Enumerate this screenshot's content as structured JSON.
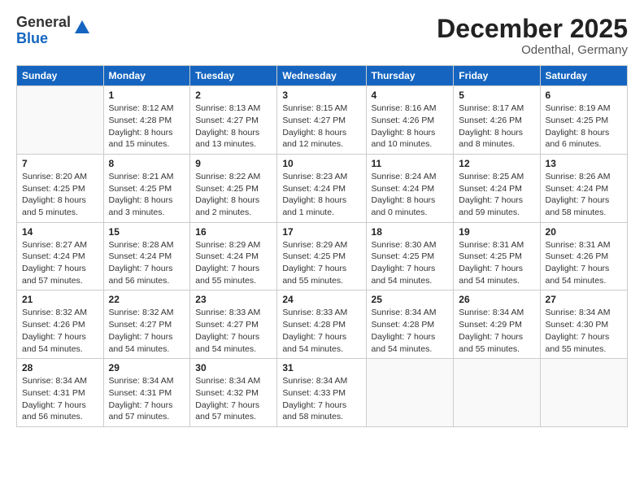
{
  "header": {
    "logo_general": "General",
    "logo_blue": "Blue",
    "month_title": "December 2025",
    "subtitle": "Odenthal, Germany"
  },
  "columns": [
    "Sunday",
    "Monday",
    "Tuesday",
    "Wednesday",
    "Thursday",
    "Friday",
    "Saturday"
  ],
  "weeks": [
    [
      {
        "day": "",
        "info": ""
      },
      {
        "day": "1",
        "info": "Sunrise: 8:12 AM\nSunset: 4:28 PM\nDaylight: 8 hours\nand 15 minutes."
      },
      {
        "day": "2",
        "info": "Sunrise: 8:13 AM\nSunset: 4:27 PM\nDaylight: 8 hours\nand 13 minutes."
      },
      {
        "day": "3",
        "info": "Sunrise: 8:15 AM\nSunset: 4:27 PM\nDaylight: 8 hours\nand 12 minutes."
      },
      {
        "day": "4",
        "info": "Sunrise: 8:16 AM\nSunset: 4:26 PM\nDaylight: 8 hours\nand 10 minutes."
      },
      {
        "day": "5",
        "info": "Sunrise: 8:17 AM\nSunset: 4:26 PM\nDaylight: 8 hours\nand 8 minutes."
      },
      {
        "day": "6",
        "info": "Sunrise: 8:19 AM\nSunset: 4:25 PM\nDaylight: 8 hours\nand 6 minutes."
      }
    ],
    [
      {
        "day": "7",
        "info": "Sunrise: 8:20 AM\nSunset: 4:25 PM\nDaylight: 8 hours\nand 5 minutes."
      },
      {
        "day": "8",
        "info": "Sunrise: 8:21 AM\nSunset: 4:25 PM\nDaylight: 8 hours\nand 3 minutes."
      },
      {
        "day": "9",
        "info": "Sunrise: 8:22 AM\nSunset: 4:25 PM\nDaylight: 8 hours\nand 2 minutes."
      },
      {
        "day": "10",
        "info": "Sunrise: 8:23 AM\nSunset: 4:24 PM\nDaylight: 8 hours\nand 1 minute."
      },
      {
        "day": "11",
        "info": "Sunrise: 8:24 AM\nSunset: 4:24 PM\nDaylight: 8 hours\nand 0 minutes."
      },
      {
        "day": "12",
        "info": "Sunrise: 8:25 AM\nSunset: 4:24 PM\nDaylight: 7 hours\nand 59 minutes."
      },
      {
        "day": "13",
        "info": "Sunrise: 8:26 AM\nSunset: 4:24 PM\nDaylight: 7 hours\nand 58 minutes."
      }
    ],
    [
      {
        "day": "14",
        "info": "Sunrise: 8:27 AM\nSunset: 4:24 PM\nDaylight: 7 hours\nand 57 minutes."
      },
      {
        "day": "15",
        "info": "Sunrise: 8:28 AM\nSunset: 4:24 PM\nDaylight: 7 hours\nand 56 minutes."
      },
      {
        "day": "16",
        "info": "Sunrise: 8:29 AM\nSunset: 4:24 PM\nDaylight: 7 hours\nand 55 minutes."
      },
      {
        "day": "17",
        "info": "Sunrise: 8:29 AM\nSunset: 4:25 PM\nDaylight: 7 hours\nand 55 minutes."
      },
      {
        "day": "18",
        "info": "Sunrise: 8:30 AM\nSunset: 4:25 PM\nDaylight: 7 hours\nand 54 minutes."
      },
      {
        "day": "19",
        "info": "Sunrise: 8:31 AM\nSunset: 4:25 PM\nDaylight: 7 hours\nand 54 minutes."
      },
      {
        "day": "20",
        "info": "Sunrise: 8:31 AM\nSunset: 4:26 PM\nDaylight: 7 hours\nand 54 minutes."
      }
    ],
    [
      {
        "day": "21",
        "info": "Sunrise: 8:32 AM\nSunset: 4:26 PM\nDaylight: 7 hours\nand 54 minutes."
      },
      {
        "day": "22",
        "info": "Sunrise: 8:32 AM\nSunset: 4:27 PM\nDaylight: 7 hours\nand 54 minutes."
      },
      {
        "day": "23",
        "info": "Sunrise: 8:33 AM\nSunset: 4:27 PM\nDaylight: 7 hours\nand 54 minutes."
      },
      {
        "day": "24",
        "info": "Sunrise: 8:33 AM\nSunset: 4:28 PM\nDaylight: 7 hours\nand 54 minutes."
      },
      {
        "day": "25",
        "info": "Sunrise: 8:34 AM\nSunset: 4:28 PM\nDaylight: 7 hours\nand 54 minutes."
      },
      {
        "day": "26",
        "info": "Sunrise: 8:34 AM\nSunset: 4:29 PM\nDaylight: 7 hours\nand 55 minutes."
      },
      {
        "day": "27",
        "info": "Sunrise: 8:34 AM\nSunset: 4:30 PM\nDaylight: 7 hours\nand 55 minutes."
      }
    ],
    [
      {
        "day": "28",
        "info": "Sunrise: 8:34 AM\nSunset: 4:31 PM\nDaylight: 7 hours\nand 56 minutes."
      },
      {
        "day": "29",
        "info": "Sunrise: 8:34 AM\nSunset: 4:31 PM\nDaylight: 7 hours\nand 57 minutes."
      },
      {
        "day": "30",
        "info": "Sunrise: 8:34 AM\nSunset: 4:32 PM\nDaylight: 7 hours\nand 57 minutes."
      },
      {
        "day": "31",
        "info": "Sunrise: 8:34 AM\nSunset: 4:33 PM\nDaylight: 7 hours\nand 58 minutes."
      },
      {
        "day": "",
        "info": ""
      },
      {
        "day": "",
        "info": ""
      },
      {
        "day": "",
        "info": ""
      }
    ]
  ]
}
